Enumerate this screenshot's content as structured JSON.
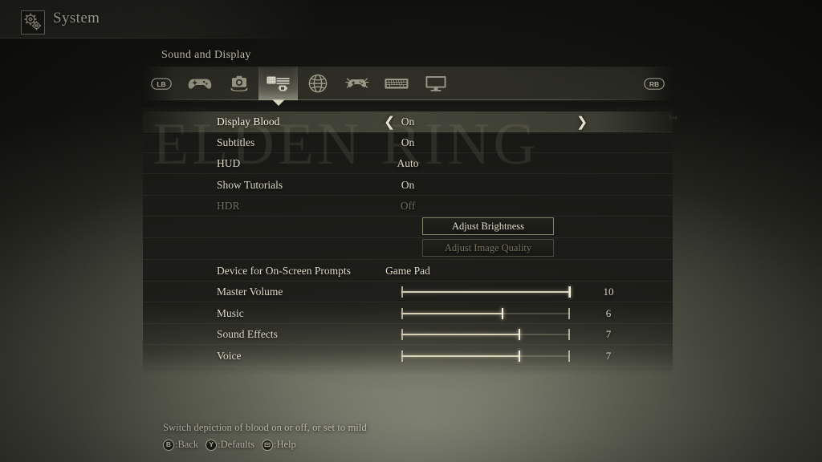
{
  "header": {
    "title": "System",
    "icon": "gears-icon"
  },
  "section": {
    "label": "Sound and Display"
  },
  "tabs": [
    {
      "name": "lb-bumper",
      "icon": "lb-button-icon",
      "label": "LB",
      "selected": false
    },
    {
      "name": "tab-controls",
      "icon": "gamepad-icon",
      "label": "Controls",
      "selected": false
    },
    {
      "name": "tab-camera",
      "icon": "camera-icon",
      "label": "Camera",
      "selected": false
    },
    {
      "name": "tab-sound-display",
      "icon": "sound-display-icon",
      "label": "Sound and Display",
      "selected": true
    },
    {
      "name": "tab-network",
      "icon": "globe-icon",
      "label": "Network",
      "selected": false
    },
    {
      "name": "tab-vibration",
      "icon": "gamepad-vibration-icon",
      "label": "Vibration",
      "selected": false
    },
    {
      "name": "tab-keyboard",
      "icon": "keyboard-icon",
      "label": "Key Bindings",
      "selected": false
    },
    {
      "name": "tab-graphics",
      "icon": "monitor-icon",
      "label": "Graphics",
      "selected": false
    },
    {
      "name": "rb-bumper",
      "icon": "rb-button-icon",
      "label": "RB",
      "selected": false
    }
  ],
  "watermark": {
    "text": "ELDEN RING",
    "trademark": "™"
  },
  "options": [
    {
      "label": "Display Blood",
      "value": "On",
      "selected": true,
      "disabled": false,
      "arrows": true
    },
    {
      "label": "Subtitles",
      "value": "On",
      "selected": false,
      "disabled": false,
      "arrows": false
    },
    {
      "label": "HUD",
      "value": "Auto",
      "selected": false,
      "disabled": false,
      "arrows": false
    },
    {
      "label": "Show Tutorials",
      "value": "On",
      "selected": false,
      "disabled": false,
      "arrows": false
    },
    {
      "label": "HDR",
      "value": "Off",
      "selected": false,
      "disabled": true,
      "arrows": false
    }
  ],
  "buttons": [
    {
      "label": "Adjust Brightness",
      "disabled": false
    },
    {
      "label": "Adjust Image Quality",
      "disabled": true
    }
  ],
  "device_row": {
    "label": "Device for On-Screen Prompts",
    "value": "Game Pad"
  },
  "sliders": [
    {
      "label": "Master Volume",
      "value": 10,
      "max": 10,
      "percent": 100
    },
    {
      "label": "Music",
      "value": 6,
      "max": 10,
      "percent": 60
    },
    {
      "label": "Sound Effects",
      "value": 7,
      "max": 10,
      "percent": 70
    },
    {
      "label": "Voice",
      "value": 7,
      "max": 10,
      "percent": 70
    }
  ],
  "footer": {
    "hint": "Switch depiction of blood on or off, or set to mild",
    "prompts": [
      {
        "glyph": "B",
        "icon": "b-button-icon",
        "label": ":Back"
      },
      {
        "glyph": "Y",
        "icon": "y-button-icon",
        "label": ":Defaults"
      },
      {
        "glyph": "",
        "icon": "view-button-icon",
        "label": ":Help"
      }
    ]
  },
  "colors": {
    "text": "#ded9c6",
    "text_bright": "#f2eeda",
    "text_disabled": "#6e6d5e",
    "accent": "#d6d6ba",
    "panel_bg": "#181814"
  }
}
